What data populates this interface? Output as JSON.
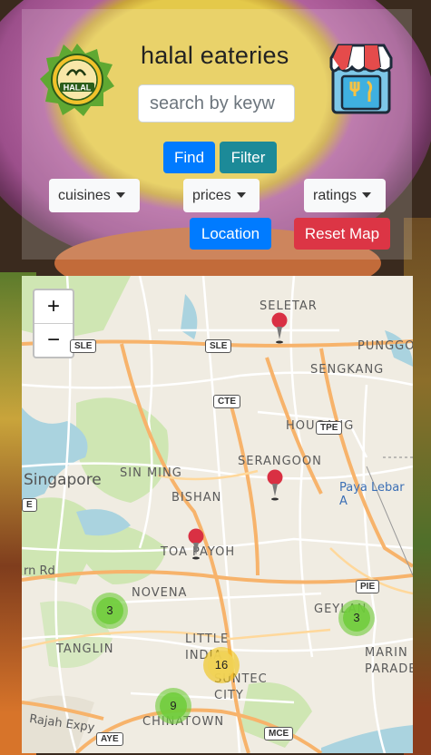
{
  "header": {
    "title": "halal eateries",
    "search_placeholder": "search by keyw",
    "find_label": "Find",
    "filter_label": "Filter",
    "location_label": "Location",
    "reset_label": "Reset Map",
    "halal_badge_text": "HALAL"
  },
  "filters": {
    "cuisines": "cuisines",
    "prices": "prices",
    "ratings": "ratings"
  },
  "map": {
    "zoom_in": "+",
    "zoom_out": "−",
    "labels": {
      "seletar": "SELETAR",
      "punggol": "PUNGGO",
      "sengkang": "SENGKANG",
      "hougang": "HOUGANG",
      "serangoon": "SERANGOON",
      "singapore": "Singapore",
      "sin_ming": "SIN MING",
      "bishan": "BISHAN",
      "paya_lebar": "Paya Lebar A",
      "toa_payoh": "TOA PAYOH",
      "novena": "NOVENA",
      "geylang": "GEYLAN",
      "tanglin": "TANGLIN",
      "little_india": "LITTLE INDIA",
      "suntec": "SUNTEC CITY",
      "marine": "MARIN",
      "parade": "PARADE",
      "chinatown": "CHINATOWN",
      "jurong_rd": "rn Rd",
      "rajah": "Rajah Expy"
    },
    "shields": {
      "sle1": "SLE",
      "sle2": "SLE",
      "cte": "CTE",
      "tpe": "TPE",
      "pie": "PIE",
      "mce": "MCE",
      "aye": "AYE",
      "e": "E"
    },
    "clusters": [
      {
        "count": "3"
      },
      {
        "count": "3"
      },
      {
        "count": "16"
      },
      {
        "count": "9"
      }
    ],
    "colors": {
      "marker": "#d93043",
      "cluster_small": "#6ecc39",
      "cluster_medium": "#f0c20c"
    }
  }
}
